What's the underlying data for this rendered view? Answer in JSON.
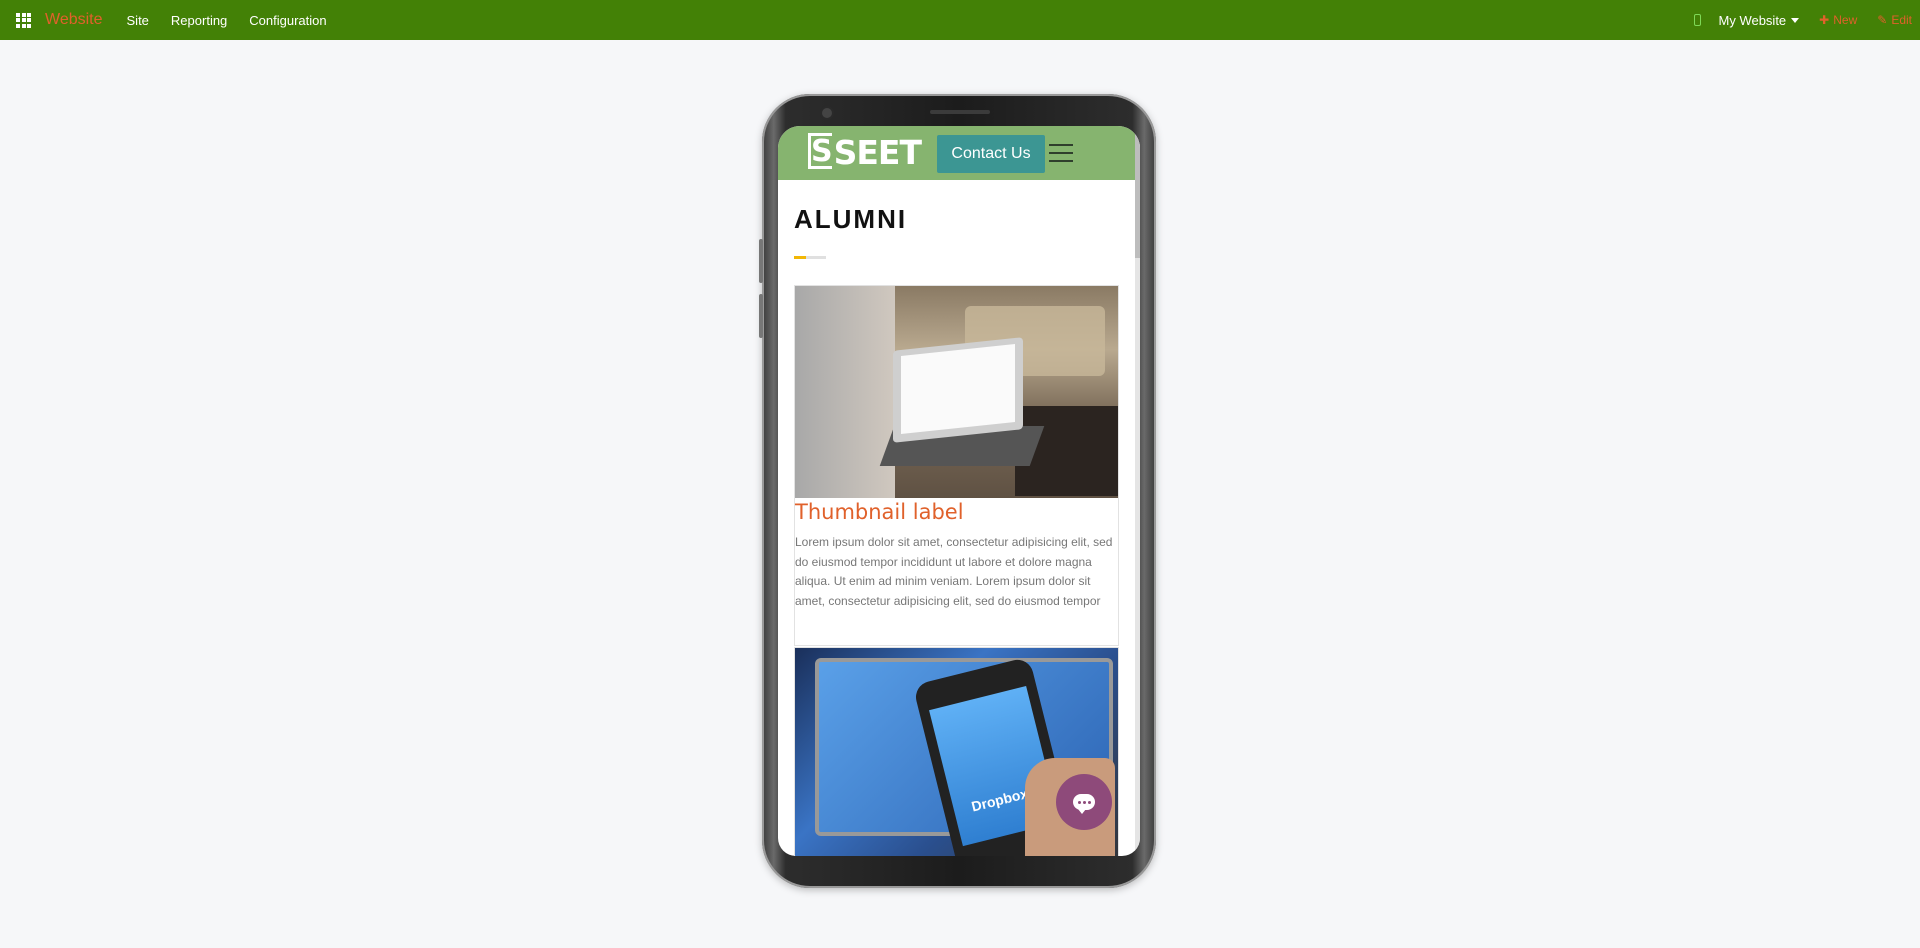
{
  "navbar": {
    "apps_icon": "apps-grid-icon",
    "brand": "Website",
    "menu": [
      "Site",
      "Reporting",
      "Configuration"
    ],
    "device_icon": "mobile-icon",
    "website_switcher": "My Website",
    "new_label": "New",
    "edit_label": "Edit",
    "colors": {
      "bar": "#438106",
      "accent": "#e0612b"
    }
  },
  "preview": {
    "header": {
      "logo_text": "SEET",
      "logo_initial": "S",
      "contact_button": "Contact Us",
      "menu_icon": "hamburger-icon",
      "background": "#86b46f",
      "button_color": "#3c9693"
    },
    "page_title": "ALUMNI",
    "cards": [
      {
        "image": "laptop-shopping-photo",
        "title": "Thumbnail label",
        "text": "Lorem ipsum dolor sit amet, consectetur adipisicing elit, sed do eiusmod tempor incididunt ut labore et dolore magna aliqua. Ut enim ad minim veniam. Lorem ipsum dolor sit amet, consectetur adipisicing elit, sed do eiusmod tempor"
      },
      {
        "image": "dropbox-phone-photo",
        "photo_text": "Dropbox"
      }
    ],
    "chat_icon": "chat-bubble-icon",
    "chat_color": "#8e4a7a"
  }
}
